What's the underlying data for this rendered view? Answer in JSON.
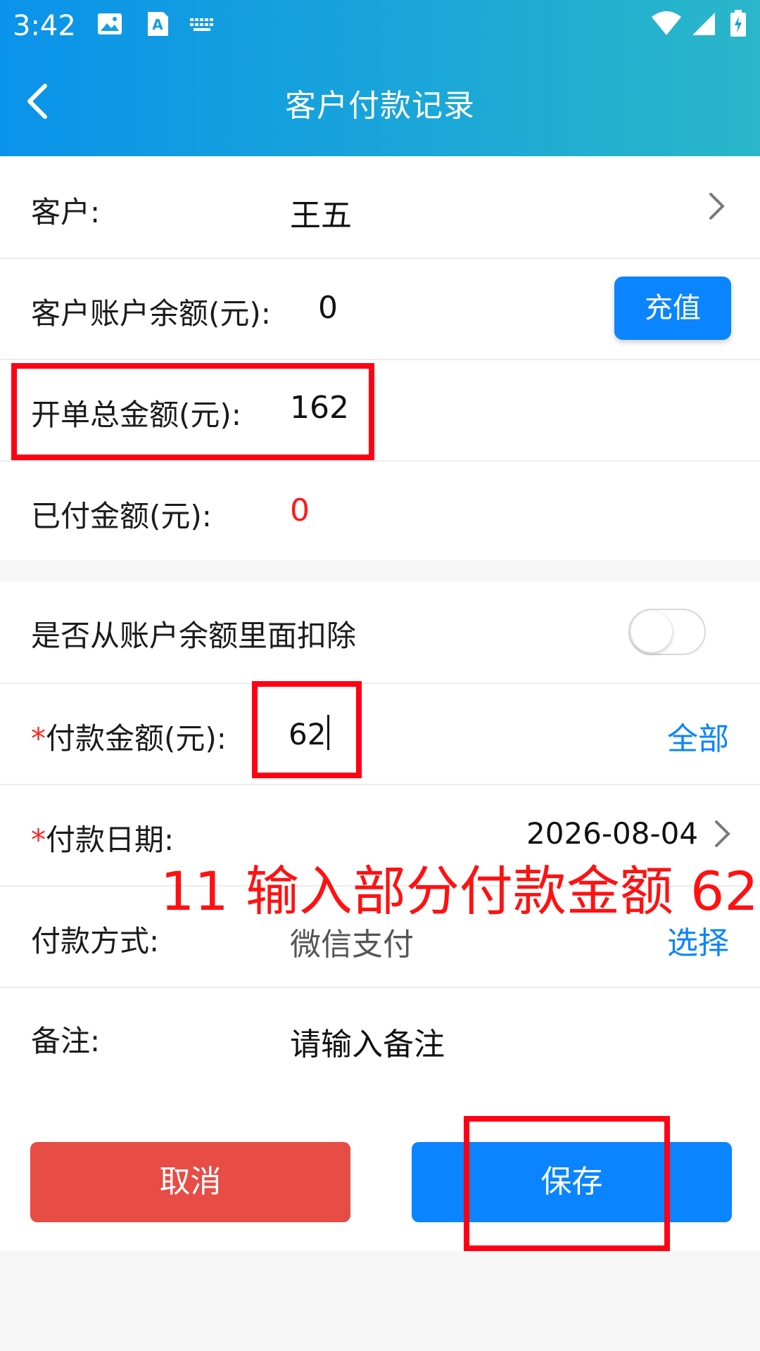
{
  "status_bar": {
    "time": "3:42"
  },
  "header": {
    "title": "客户付款记录"
  },
  "rows": {
    "customer": {
      "label": "客户:",
      "value": "王五"
    },
    "balance": {
      "label": "客户账户余额(元):",
      "value": "0",
      "button": "充值"
    },
    "total": {
      "label": "开单总金额(元):",
      "value": "162"
    },
    "paid": {
      "label": "已付金额(元):",
      "value": "0"
    },
    "deduct": {
      "label": "是否从账户余额里面扣除",
      "enabled": false
    },
    "amount": {
      "required_mark": "*",
      "label": "付款金额(元):",
      "value": "62",
      "link": "全部"
    },
    "date": {
      "required_mark": "*",
      "label": "付款日期:",
      "value": "2026-08-04"
    },
    "method": {
      "label": "付款方式:",
      "value": "微信支付",
      "link": "选择"
    },
    "note": {
      "label": "备注:",
      "placeholder": "请输入备注"
    }
  },
  "annotation": "11 输入部分付款金额 62",
  "buttons": {
    "cancel": "取消",
    "save": "保存"
  },
  "colors": {
    "accent": "#0a84ff",
    "cancel": "#e74c45",
    "highlight": "#ff0014",
    "header_start": "#0a93ea",
    "header_end": "#2ab7c9"
  }
}
